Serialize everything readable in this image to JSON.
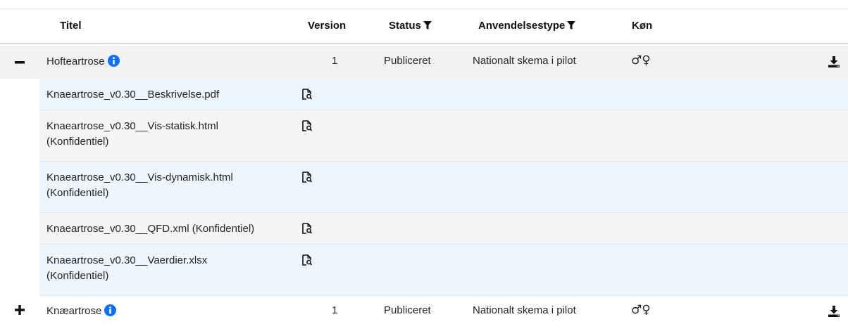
{
  "headers": {
    "title": "Titel",
    "version": "Version",
    "status": "Status",
    "usage": "Anvendelsestype",
    "gender": "Køn"
  },
  "rows": [
    {
      "toggle": "−",
      "title": "Hofteartrose",
      "version": "1",
      "status": "Publiceret",
      "usage": "Nationalt skema i pilot",
      "gender": "♂♀",
      "files": [
        {
          "line1": "Knaeartrose_v0.30__Beskrivelse.pdf",
          "line2": ""
        },
        {
          "line1": "Knaeartrose_v0.30__Vis-statisk.html",
          "line2": "(Konfidentiel)"
        },
        {
          "line1": "Knaeartrose_v0.30__Vis-dynamisk.html",
          "line2": "(Konfidentiel)"
        },
        {
          "line1": "Knaeartrose_v0.30__QFD.xml (Konfidentiel)",
          "line2": ""
        },
        {
          "line1": "Knaeartrose_v0.30__Vaerdier.xlsx",
          "line2": "(Konfidentiel)"
        }
      ]
    },
    {
      "toggle": "+",
      "title": "Knæartrose",
      "version": "1",
      "status": "Publiceret",
      "usage": "Nationalt skema i pilot",
      "gender": "♂♀"
    }
  ],
  "colors": {
    "expanded_row_bg": "#f2f2f2",
    "file_row_bg_a": "#eef6fd",
    "file_row_bg_b": "#f5f5f5",
    "info_blue": "#0d6efd"
  }
}
